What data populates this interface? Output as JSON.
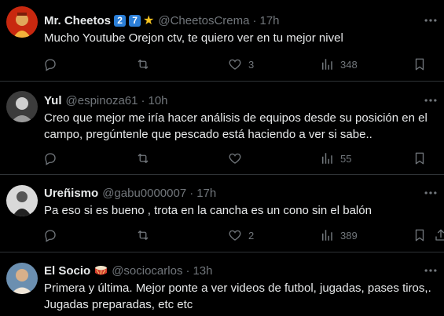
{
  "tweets": [
    {
      "name": "Mr. Cheetos",
      "badges": [
        "2",
        "7"
      ],
      "handle": "@CheetosCrema",
      "time": "17h",
      "text": "Mucho Youtube Orejon ctv, te quiero ver en tu mejor nivel",
      "likes": "3",
      "views": "348"
    },
    {
      "name": "Yul",
      "handle": "@espinoza61",
      "time": "10h",
      "text": "Creo que mejor me iría hacer análisis de equipos desde su posición en el campo, pregúntenle que pescado está haciendo a ver si sabe..",
      "views": "55"
    },
    {
      "name": "Ureñismo",
      "handle": "@gabu0000007",
      "time": "17h",
      "text": "Pa eso si es bueno , trota en la cancha es un cono sin el balón",
      "likes": "2",
      "views": "389"
    },
    {
      "name": "El Socio",
      "handle": "@sociocarlos",
      "time": "13h",
      "text": "Primera y última. Mejor ponte a ver videos de futbol, jugadas, pases tiros,. Jugadas preparadas, etc etc"
    }
  ],
  "separator": "·",
  "colors": {
    "background": "#000000",
    "text": "#e7e9ea",
    "secondary": "#71767b",
    "divider": "#2f3336",
    "badge": "#2b7fd8"
  },
  "icons": [
    "more-icon",
    "reply-icon",
    "retweet-icon",
    "like-icon",
    "views-icon",
    "bookmark-icon",
    "share-icon",
    "star-icon",
    "drum-icon"
  ]
}
